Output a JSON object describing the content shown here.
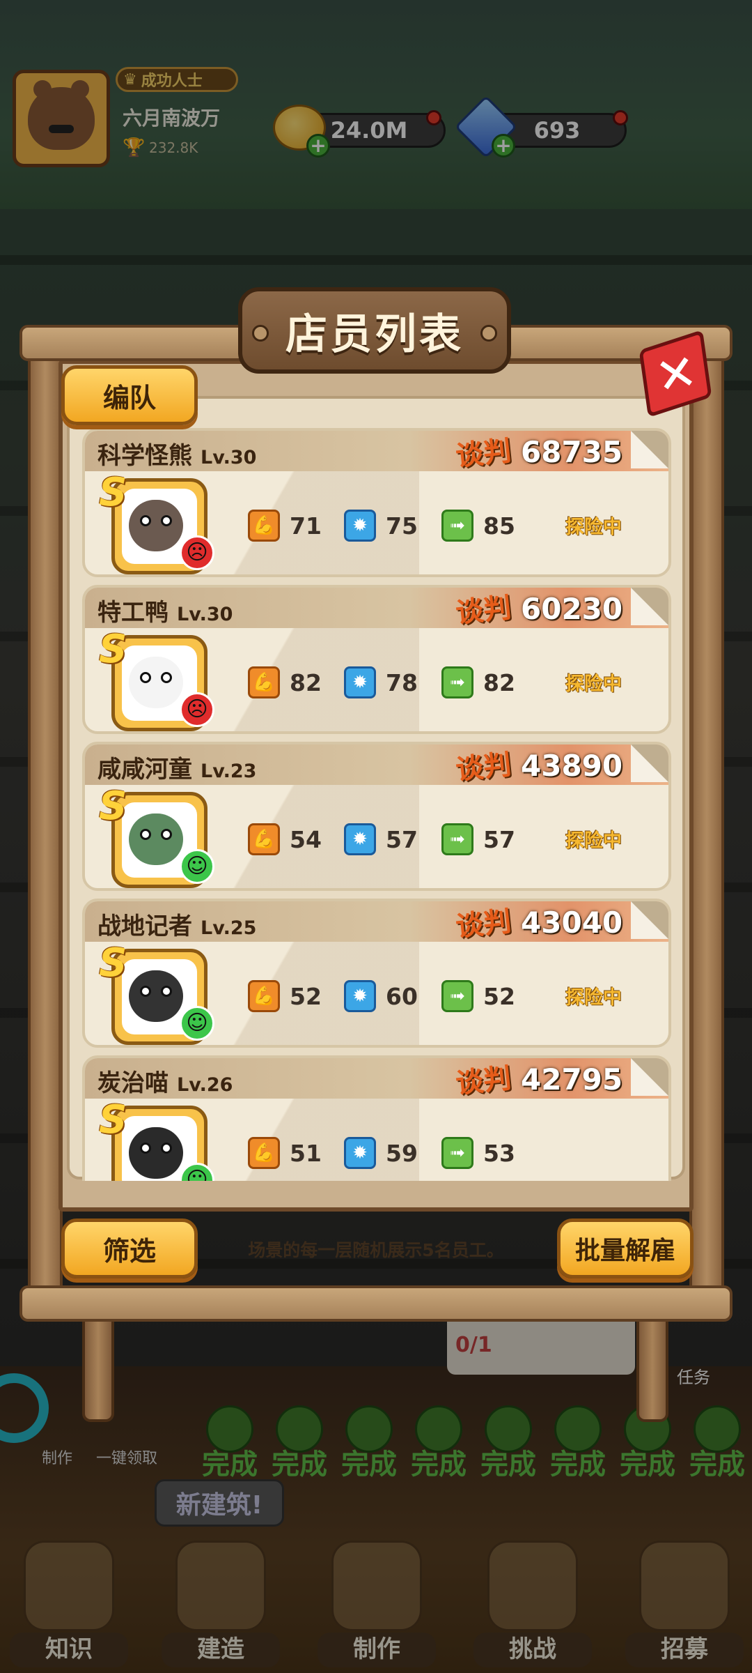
{
  "hud": {
    "player_title": "成功人士",
    "player_name": "六月南波万",
    "trophy_score": "232.8K",
    "gold": "24.0M",
    "gems": "693"
  },
  "dialog": {
    "title": "店员列表",
    "team_button": "编队",
    "filter_button": "筛选",
    "batch_fire_button": "批量解雇",
    "hint": "场景的每一层随机展示5名员工。",
    "negotiate_label": "谈判"
  },
  "employees": [
    {
      "name": "科学怪熊",
      "level": "Lv.30",
      "negotiation": "68735",
      "rank": "S",
      "mood": "angry",
      "strength": "71",
      "intellect": "75",
      "agility": "85",
      "status": "探险中",
      "avatar_color": "#6b5a50"
    },
    {
      "name": "特工鸭",
      "level": "Lv.30",
      "negotiation": "60230",
      "rank": "S",
      "mood": "angry",
      "strength": "82",
      "intellect": "78",
      "agility": "82",
      "status": "探险中",
      "avatar_color": "#f4f4f4"
    },
    {
      "name": "咸咸河童",
      "level": "Lv.23",
      "negotiation": "43890",
      "rank": "S",
      "mood": "happy",
      "strength": "54",
      "intellect": "57",
      "agility": "57",
      "status": "探险中",
      "avatar_color": "#5c8a60"
    },
    {
      "name": "战地记者",
      "level": "Lv.25",
      "negotiation": "43040",
      "rank": "S",
      "mood": "happy",
      "strength": "52",
      "intellect": "60",
      "agility": "52",
      "status": "探险中",
      "avatar_color": "#333333"
    },
    {
      "name": "炭治喵",
      "level": "Lv.26",
      "negotiation": "42795",
      "rank": "S",
      "mood": "happy",
      "strength": "51",
      "intellect": "59",
      "agility": "53",
      "status": "",
      "avatar_color": "#2a2a2a"
    }
  ],
  "background": {
    "task_progress": "0/1",
    "tasks_label": "任务",
    "make_link": "制作",
    "collect_all_link": "一键领取",
    "done_label": "完成",
    "new_building_bubble": "新建筑!"
  },
  "nav": {
    "knowledge": "知识",
    "build": "建造",
    "craft": "制作",
    "challenge": "挑战",
    "recruit": "招募"
  }
}
